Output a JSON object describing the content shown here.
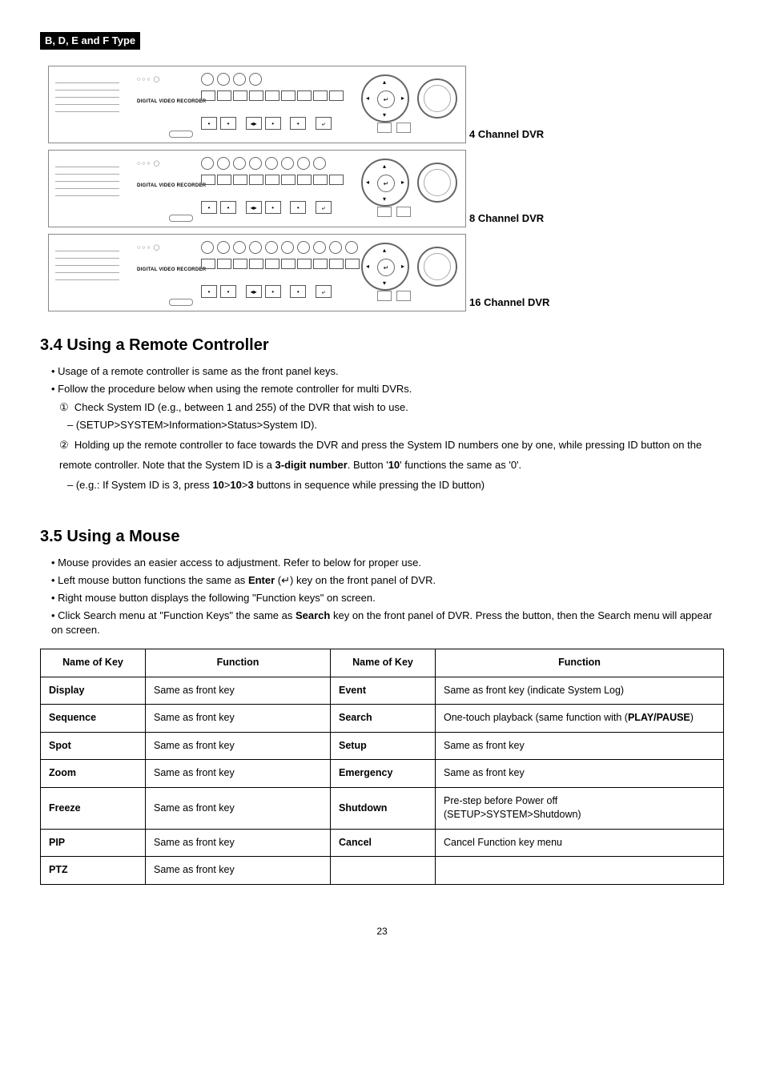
{
  "typeHeader": "B, D, E and F Type",
  "panels": [
    {
      "label": "4 Channel DVR",
      "channels": 4,
      "panelText": "DIGITAL VIDEO RECORDER"
    },
    {
      "label": "8 Channel DVR",
      "channels": 8,
      "panelText": "DIGITAL VIDEO RECORDER"
    },
    {
      "label": "16 Channel DVR",
      "channels": 10,
      "panelText": "DIGITAL VIDEO RECORDER"
    }
  ],
  "section34": {
    "title": "3.4  Using a Remote Controller",
    "b1": "Usage of a remote controller is same as the front panel keys.",
    "b2": "Follow the procedure below when using the remote controller for multi DVRs.",
    "s1_num": "①",
    "s1": "Check System ID (e.g., between 1 and 255) of the DVR that wish to use.",
    "s1a": "– (SETUP>SYSTEM>Information>Status>System ID).",
    "s2_num": "②",
    "s2_a": "Holding up the remote controller to face towards the DVR and press the System ID numbers one by one, while pressing ID button on the remote controller. Note that the System ID is a ",
    "s2_bold": "3-digit number",
    "s2_b": ". Button '",
    "s2_bold2": "10",
    "s2_c": "' functions the same as '0'.",
    "s2a_a": "– (e.g.: If System ID is 3, press ",
    "s2a_b1": "10",
    "s2a_gt1": ">",
    "s2a_b2": "10",
    "s2a_gt2": ">",
    "s2a_b3": "3",
    "s2a_c": " buttons in sequence while pressing the ID button)"
  },
  "section35": {
    "title": "3.5  Using a Mouse",
    "b1": "Mouse provides an easier access to adjustment. Refer to below for proper use.",
    "b2_a": "Left mouse button functions the same as ",
    "b2_bold": "Enter",
    "b2_b": " (↵) key on the front panel of DVR.",
    "b3": "Right mouse button displays the following \"Function keys\" on screen.",
    "b4_a": "Click Search menu at \"Function Keys\" the same as ",
    "b4_bold": "Search",
    "b4_b": " key on the front panel of DVR. Press the button, then the Search menu will appear on screen."
  },
  "table": {
    "h1": "Name of Key",
    "h2": "Function",
    "h3": "Name of Key",
    "h4": "Function",
    "rows": [
      {
        "n1": "Display",
        "f1": "Same as front key",
        "n2": "Event",
        "f2": "Same as front key (indicate System Log)"
      },
      {
        "n1": "Sequence",
        "f1": "Same as front key",
        "n2": "Search",
        "f2_a": "One-touch playback (same function with (",
        "f2_bold": "PLAY/PAUSE",
        "f2_b": ")"
      },
      {
        "n1": "Spot",
        "f1": "Same as front key",
        "n2": "Setup",
        "f2": "Same as front key"
      },
      {
        "n1": "Zoom",
        "f1": "Same as front key",
        "n2": "Emergency",
        "f2": "Same as front key"
      },
      {
        "n1": "Freeze",
        "f1": "Same as front key",
        "n2": "Shutdown",
        "f2": "Pre-step before Power off\n(SETUP>SYSTEM>Shutdown)"
      },
      {
        "n1": "PIP",
        "f1": "Same as front key",
        "n2": "Cancel",
        "f2": "Cancel Function key menu"
      },
      {
        "n1": "PTZ",
        "f1": "Same as front key",
        "n2": "",
        "f2": ""
      }
    ]
  },
  "pageNumber": "23"
}
